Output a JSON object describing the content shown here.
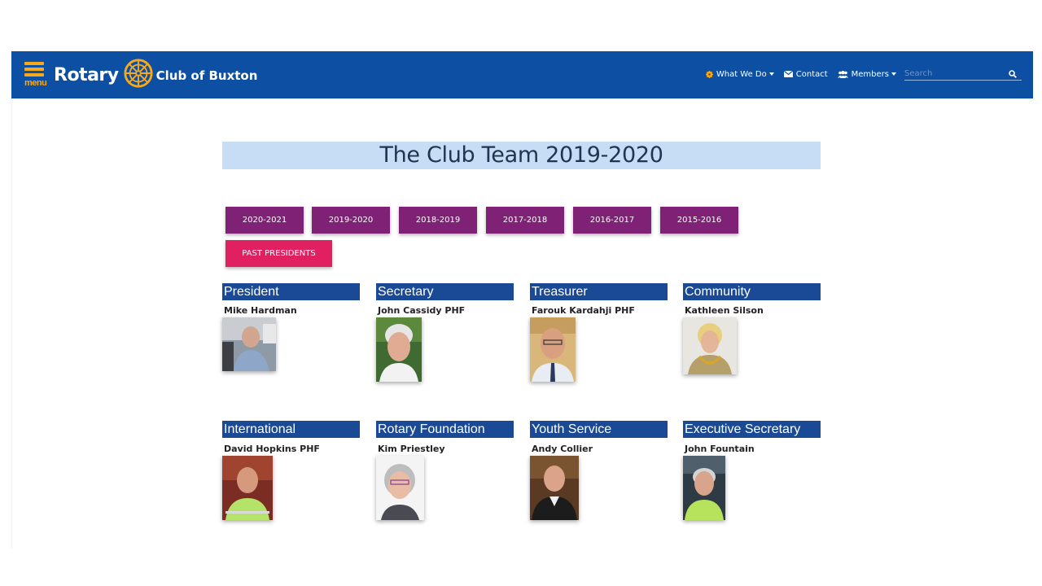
{
  "nav": {
    "menu_label": "menu",
    "logo_rotary": "Rotary",
    "logo_club": "Club of Buxton",
    "items": [
      {
        "label": "What We Do",
        "icon": "gear-icon"
      },
      {
        "label": "Contact",
        "icon": "envelope-icon"
      },
      {
        "label": "Members",
        "icon": "users-icon"
      }
    ],
    "search_placeholder": "Search"
  },
  "page": {
    "title": "The Club Team 2019-2020"
  },
  "year_buttons": [
    "2020-2021",
    "2019-2020",
    "2018-2019",
    "2017-2018",
    "2016-2017",
    "2015-2016"
  ],
  "past_presidents_label": "PAST PRESIDENTS",
  "team": [
    {
      "role": "President",
      "name": "Mike Hardman"
    },
    {
      "role": "Secretary",
      "name": "John Cassidy PHF"
    },
    {
      "role": "Treasurer",
      "name": "Farouk Kardahji PHF"
    },
    {
      "role": "Community",
      "name": "Kathleen Silson"
    },
    {
      "role": "International",
      "name": "David Hopkins PHF"
    },
    {
      "role": "Rotary Foundation",
      "name": "Kim Priestley"
    },
    {
      "role": "Youth Service",
      "name": "Andy Collier"
    },
    {
      "role": "Executive Secretary",
      "name": "John Fountain"
    }
  ],
  "colors": {
    "navbar": "#0c4fa3",
    "accent_gold": "#f7a81b",
    "year_button": "#7f2175",
    "past_presidents_button": "#e02061",
    "role_header": "#1a4a96",
    "title_bg": "#c7dcf5"
  }
}
